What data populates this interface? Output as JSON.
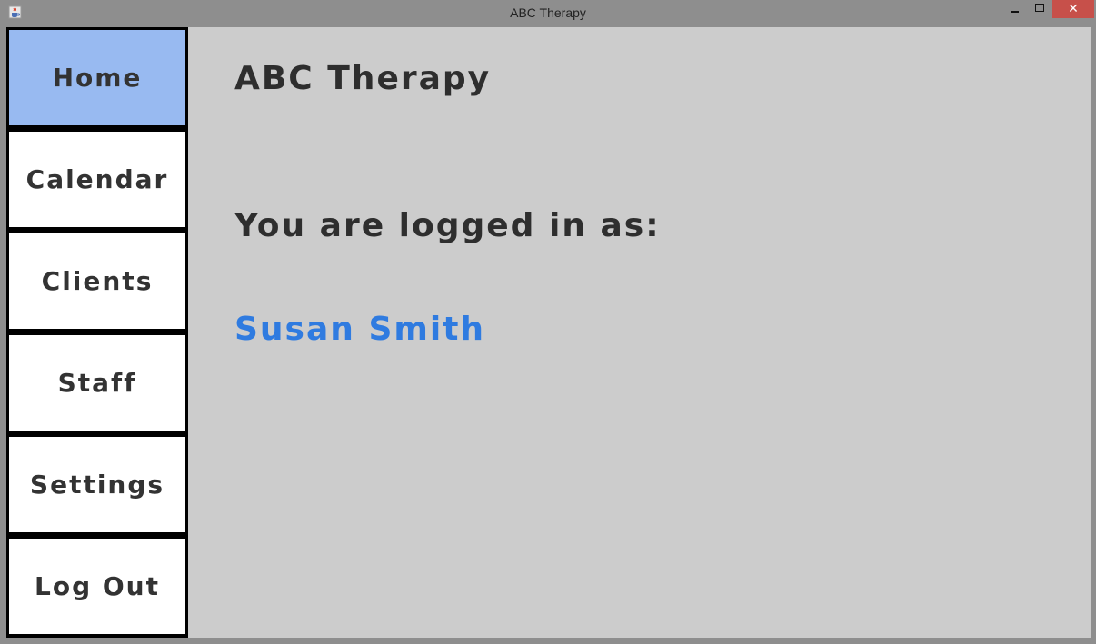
{
  "window": {
    "title": "ABC Therapy",
    "app_icon": "java-cup-icon",
    "close_symbol": "✕"
  },
  "sidebar": {
    "items": [
      {
        "label": "Home",
        "active": true
      },
      {
        "label": "Calendar",
        "active": false
      },
      {
        "label": "Clients",
        "active": false
      },
      {
        "label": "Staff",
        "active": false
      },
      {
        "label": "Settings",
        "active": false
      },
      {
        "label": "Log Out",
        "active": false
      }
    ],
    "active_color": "#98baf1"
  },
  "main": {
    "heading": "ABC Therapy",
    "logged_in_label": "You are logged in as:",
    "user_name": "Susan Smith",
    "user_name_color": "#2f7be0"
  }
}
